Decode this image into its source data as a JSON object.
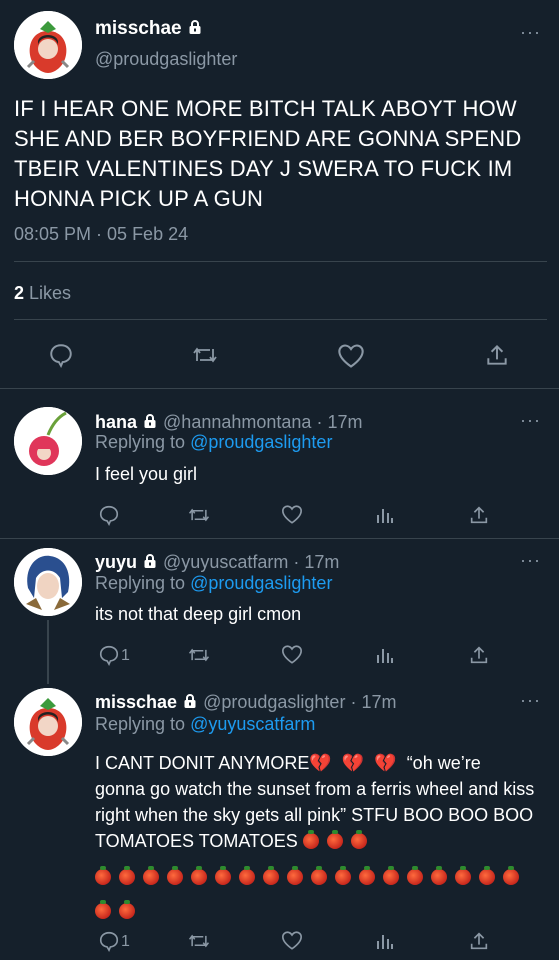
{
  "main_tweet": {
    "display_name": "misschae",
    "handle": "@proudgaslighter",
    "text": "IF I HEAR ONE MORE BITCH TALK ABOYT HOW SHE AND BER BOYFRIEND ARE GONNA SPEND TBEIR VALENTINES DAY J SWERA TO FUCK IM HONNA PICK UP A GUN",
    "time": "08:05 PM · 05 Feb 24",
    "likes_count": "2",
    "likes_label": "Likes"
  },
  "replies": [
    {
      "display_name": "hana",
      "handle": "@hannahmontana",
      "age": "17m",
      "replying_label": "Replying to",
      "replying_to": "@proudgaslighter",
      "text": "I feel you girl",
      "reply_count": ""
    },
    {
      "display_name": "yuyu",
      "handle": "@yuyuscatfarm",
      "age": "17m",
      "replying_label": "Replying to",
      "replying_to": "@proudgaslighter",
      "text": "its not that deep girl cmon",
      "reply_count": "1"
    },
    {
      "display_name": "misschae",
      "handle": "@proudgaslighter",
      "age": "17m",
      "replying_label": "Replying to",
      "replying_to": "@yuyuscatfarm",
      "text_part1": "I CANT DONIT ANYMORE",
      "text_part2": "“oh we’re gonna go watch the sunset from a ferris wheel and kiss right when the sky gets all pink” STFU BOO BOO BOO TOMATOES TOMATOES",
      "reply_count": "1"
    }
  ],
  "separator": "·",
  "more_glyph": "···"
}
